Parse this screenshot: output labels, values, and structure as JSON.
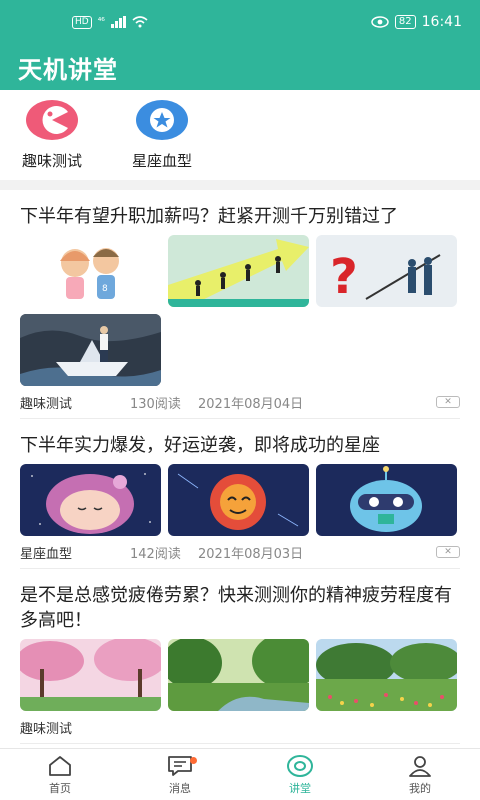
{
  "status_bar": {
    "hd": "HD",
    "network": "⁴⁶",
    "battery": "82",
    "time": "16:41"
  },
  "header": {
    "title": "天机讲堂"
  },
  "quick_entries": [
    {
      "label": "趣味测试",
      "icon": "pacman-face-icon",
      "color": "#ef5a78"
    },
    {
      "label": "星座血型",
      "icon": "star-icon",
      "color": "#3b8de0"
    }
  ],
  "articles": [
    {
      "title": "下半年有望升职加薪吗？赶紧开测千万别错过了",
      "category": "趣味测试",
      "reads": "130阅读",
      "date": "2021年08月04日",
      "close": "✕"
    },
    {
      "title": "下半年实力爆发，好运逆袭，即将成功的星座",
      "category": "星座血型",
      "reads": "142阅读",
      "date": "2021年08月03日",
      "close": "✕"
    },
    {
      "title": "是不是总感觉疲倦劳累？快来测测你的精神疲劳程度有多高吧！",
      "category": "趣味测试",
      "reads": "",
      "date": "",
      "close": ""
    }
  ],
  "bottom_nav": [
    {
      "label": "首页",
      "icon": "home-icon"
    },
    {
      "label": "消息",
      "icon": "message-icon"
    },
    {
      "label": "讲堂",
      "icon": "lecture-icon"
    },
    {
      "label": "我的",
      "icon": "user-icon"
    }
  ],
  "colors": {
    "brand": "#2fb59a",
    "badge_dot": "#ff6b35"
  }
}
